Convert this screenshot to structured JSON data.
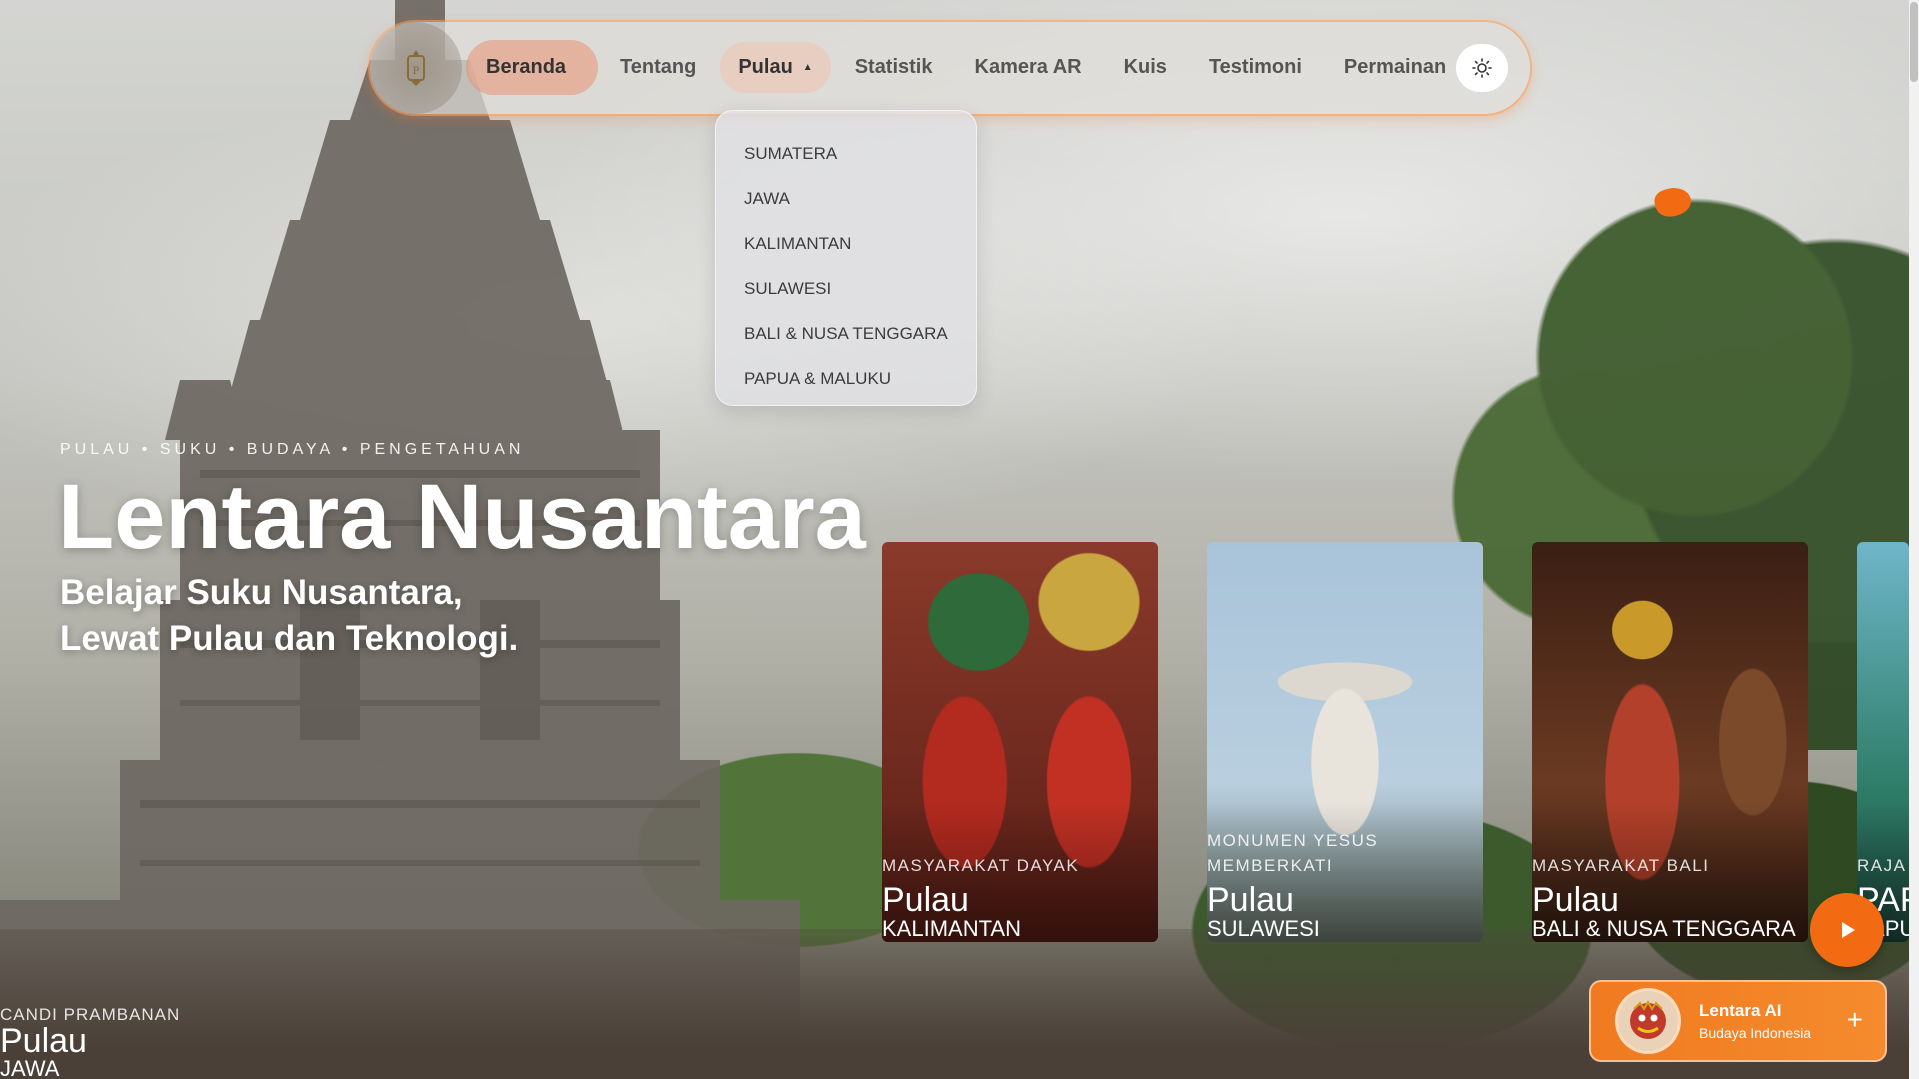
{
  "nav": {
    "items": [
      {
        "label": "Beranda",
        "active": true
      },
      {
        "label": "Tentang"
      },
      {
        "label": "Pulau",
        "open": true
      },
      {
        "label": "Statistik"
      },
      {
        "label": "Kamera AR"
      },
      {
        "label": "Kuis"
      },
      {
        "label": "Testimoni"
      },
      {
        "label": "Permainan"
      }
    ],
    "theme_icon": "sun-icon",
    "logo_icon": "lantern-logo-icon"
  },
  "dropdown": {
    "items": [
      "SUMATERA",
      "JAWA",
      "KALIMANTAN",
      "SULAWESI",
      "BALI & NUSA TENGGARA",
      "PAPUA & MALUKU"
    ]
  },
  "hero": {
    "eyebrow": "PULAU • SUKU • BUDAYA • PENGETAHUAN",
    "title": "Lentara Nusantara",
    "subtitle_line1": "Belajar Suku Nusantara,",
    "subtitle_line2": "Lewat Pulau dan Teknologi."
  },
  "background_card": {
    "label": "CANDI PRAMBANAN",
    "pulau": "Pulau",
    "name": "JAWA"
  },
  "cards": [
    {
      "label": "MASYARAKAT DAYAK",
      "pulau": "Pulau",
      "name": "KALIMANTAN"
    },
    {
      "label": "MONUMEN YESUS MEMBERKATI",
      "pulau": "Pulau",
      "name": "SULAWESI"
    },
    {
      "label": "MASYARAKAT BALI",
      "pulau": "Pulau",
      "name": "BALI & NUSA TENGGARA"
    },
    {
      "label": "RAJA",
      "pulau": "PAF",
      "name": "PAPU"
    }
  ],
  "play_button": {
    "icon": "play-icon"
  },
  "ai_widget": {
    "title": "Lentara AI",
    "subtitle": "Budaya Indonesia",
    "plus": "+"
  },
  "colors": {
    "accent": "#f26a12",
    "nav_active": "#e6a58c"
  }
}
